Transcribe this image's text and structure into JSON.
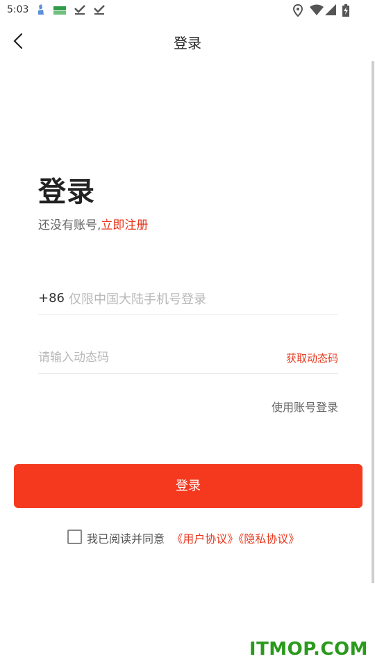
{
  "status_bar": {
    "time": "5:03"
  },
  "header": {
    "title": "登录"
  },
  "login": {
    "heading": "登录",
    "no_account_text": "还没有账号,",
    "register_link": "立即注册",
    "country_code": "+86",
    "phone_placeholder": "仅限中国大陆手机号登录",
    "code_placeholder": "请输入动态码",
    "get_code_label": "获取动态码",
    "account_login_label": "使用账号登录",
    "submit_label": "登录"
  },
  "agreement": {
    "checked": false,
    "prefix": "我已阅读并同意",
    "user_agreement": "《用户协议》",
    "privacy_agreement": "《隐私协议》"
  },
  "watermark": "ITMOP.COM",
  "colors": {
    "accent": "#f5391f",
    "link": "#e8391f"
  }
}
